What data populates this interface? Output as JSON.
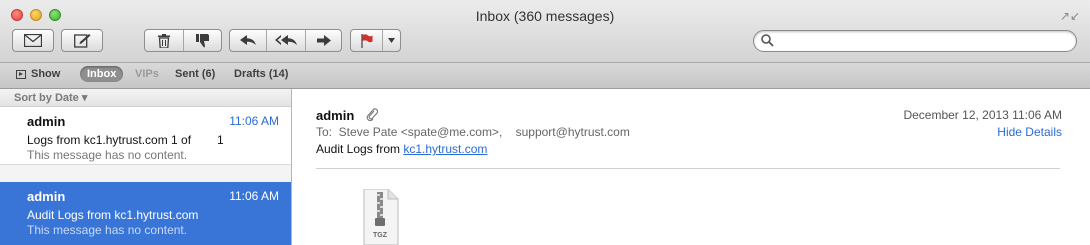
{
  "window": {
    "title": "Inbox (360 messages)"
  },
  "toolbar": {
    "search": {
      "placeholder": "",
      "value": ""
    }
  },
  "favorites": {
    "show": "Show",
    "inbox": "Inbox",
    "vips": "VIPs",
    "sent": "Sent (6)",
    "drafts": "Drafts (14)"
  },
  "list": {
    "sort_label": "Sort by Date ▾",
    "messages": [
      {
        "from": "admin",
        "time": "11:06 AM",
        "subject": "Logs from kc1.hytrust.com 1 of",
        "count": "1",
        "preview": "This message has no content."
      },
      {
        "from": "admin",
        "time": "11:06 AM",
        "subject": "Audit Logs from kc1.hytrust.com",
        "preview": "This message has no content."
      }
    ]
  },
  "reading": {
    "from": "admin",
    "date": "December 12, 2013  11:06 AM",
    "to": "To:  Steve Pate <spate@me.com>,    support@hytrust.com",
    "hide_details": "Hide Details",
    "subject_prefix": "Audit Logs from ",
    "subject_link": "kc1.hytrust.com",
    "attachment_type": "TGZ"
  },
  "colors": {
    "selection": "#3875d7",
    "link": "#2b6bd6",
    "flag": "#d0332d"
  }
}
